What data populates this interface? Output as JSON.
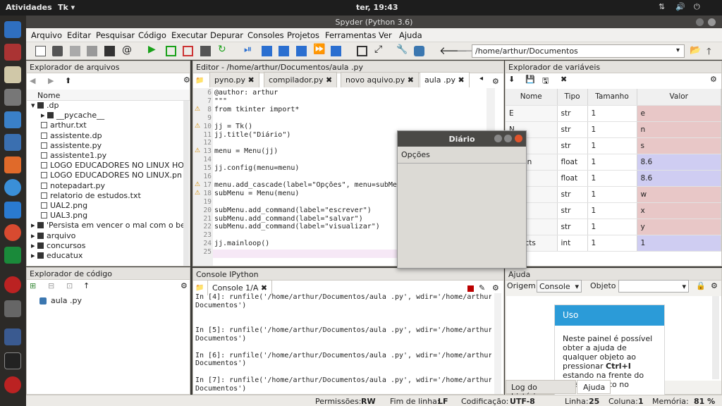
{
  "topbar": {
    "activities": "Atividades",
    "app": "Tk ▾",
    "clock": "ter, 19:43"
  },
  "window": {
    "title": "Spyder (Python 3.6)"
  },
  "menu": [
    "Arquivo",
    "Editar",
    "Pesquisar",
    "Código",
    "Executar",
    "Depurar",
    "Consoles",
    "Projetos",
    "Ferramentas",
    "Ver",
    "Ajuda"
  ],
  "toolbar": {
    "path": "/home/arthur/Documentos"
  },
  "file_explorer": {
    "title": "Explorador de arquivos",
    "header": "Nome",
    "items": [
      ".dp",
      "__pycache__",
      "arthur.txt",
      "assistente.dp",
      "assistente.py",
      "assistente1.py",
      "LOGO EDUCADORES NO LINUX HO",
      "LOGO EDUCADORES NO LINUX.pn",
      "notepadart.py",
      "relatorio de estudos.txt",
      "UAL2.png",
      "UAL3.png",
      "'Persista em vencer o mal com o bem",
      "arquivo",
      "concursos",
      "educatux"
    ]
  },
  "code_explorer": {
    "title": "Explorador de código",
    "item": "aula .py"
  },
  "editor": {
    "title": "Editor - /home/arthur/Documentos/aula .py",
    "tabs": [
      "pyno.py",
      "compilador.py",
      "novo aquivo.py",
      "aula .py"
    ],
    "lines": [
      {
        "n": "6",
        "t": "@author: arthur"
      },
      {
        "n": "7",
        "t": "\"\"\""
      },
      {
        "n": "8",
        "t": "from tkinter import*"
      },
      {
        "n": "9",
        "t": ""
      },
      {
        "n": "10",
        "t": "jj = Tk()"
      },
      {
        "n": "11",
        "t": "jj.title(\"Diário\")"
      },
      {
        "n": "12",
        "t": ""
      },
      {
        "n": "13",
        "t": "menu = Menu(jj)"
      },
      {
        "n": "14",
        "t": ""
      },
      {
        "n": "15",
        "t": "jj.config(menu=menu)"
      },
      {
        "n": "16",
        "t": ""
      },
      {
        "n": "17",
        "t": "menu.add_cascade(label=\"Opções\", menu=subMenu)"
      },
      {
        "n": "18",
        "t": "subMenu = Menu(menu)"
      },
      {
        "n": "19",
        "t": ""
      },
      {
        "n": "20",
        "t": "subMenu.add_command(label=\"escrever\")"
      },
      {
        "n": "21",
        "t": "subMenu.add_command(label=\"salvar\")"
      },
      {
        "n": "22",
        "t": "subMenu.add_command(label=\"visualizar\")"
      },
      {
        "n": "23",
        "t": ""
      },
      {
        "n": "24",
        "t": "jj.mainloop()"
      },
      {
        "n": "25",
        "t": ""
      }
    ]
  },
  "variables": {
    "title": "Explorador de variáveis",
    "headers": [
      "Nome",
      "Tipo",
      "Tamanho",
      "Valor"
    ],
    "rows": [
      {
        "name": "E",
        "type": "str",
        "size": "1",
        "value": "e",
        "color": "#e8c7c7"
      },
      {
        "name": "N",
        "type": "str",
        "size": "1",
        "value": "n",
        "color": "#e8c7c7"
      },
      {
        "name": "S",
        "type": "str",
        "size": "1",
        "value": "s",
        "color": "#e8c7c7"
      },
      {
        "name": "ersion",
        "type": "float",
        "size": "1",
        "value": "8.6",
        "color": "#cfcdf2"
      },
      {
        "name": "rsion",
        "type": "float",
        "size": "1",
        "value": "8.6",
        "color": "#cfcdf2"
      },
      {
        "name": "",
        "type": "str",
        "size": "1",
        "value": "w",
        "color": "#e8c7c7"
      },
      {
        "name": "",
        "type": "str",
        "size": "1",
        "value": "x",
        "color": "#e8c7c7"
      },
      {
        "name": "",
        "type": "str",
        "size": "1",
        "value": "y",
        "color": "#e8c7c7"
      },
      {
        "name": "objects",
        "type": "int",
        "size": "1",
        "value": "1",
        "color": "#cfcdf2"
      }
    ]
  },
  "console": {
    "title": "Console IPython",
    "tab": "Console 1/A",
    "lines": [
      "In [4]: runfile('/home/arthur/Documentos/aula .py', wdir='/home/arthur/",
      "Documentos')",
      "",
      "",
      "In [5]: runfile('/home/arthur/Documentos/aula .py', wdir='/home/arthur/",
      "Documentos')",
      "",
      "In [6]: runfile('/home/arthur/Documentos/aula .py', wdir='/home/arthur/",
      "Documentos')",
      "",
      "In [7]: runfile('/home/arthur/Documentos/aula .py', wdir='/home/arthur/",
      "Documentos')"
    ]
  },
  "help": {
    "title": "Ajuda",
    "origem_label": "Origem",
    "origem_value": "Console",
    "objeto_label": "Objeto",
    "card_title": "Uso",
    "card_text1": "Neste painel é possível obter a ajuda de qualquer objeto ao pressionar",
    "card_bold": "Ctrl+I",
    "card_text2": " estando na frente do mesmo, tanto no",
    "tabs": [
      "Log do histórico",
      "Ajuda"
    ]
  },
  "dialog": {
    "title": "Diário",
    "menu": "Opções"
  },
  "status": {
    "perm_label": "Permissões:",
    "perm": "RW",
    "eol_label": "Fim de linha:",
    "eol": "LF",
    "enc_label": "Codificação:",
    "enc": "UTF-8",
    "line_label": "Linha:",
    "line": "25",
    "col_label": "Coluna:",
    "col": "1",
    "mem_label": "Memória:",
    "mem": "81 %"
  },
  "colors": {
    "accent": "#2b9bd8",
    "run": "#1aa11a"
  }
}
